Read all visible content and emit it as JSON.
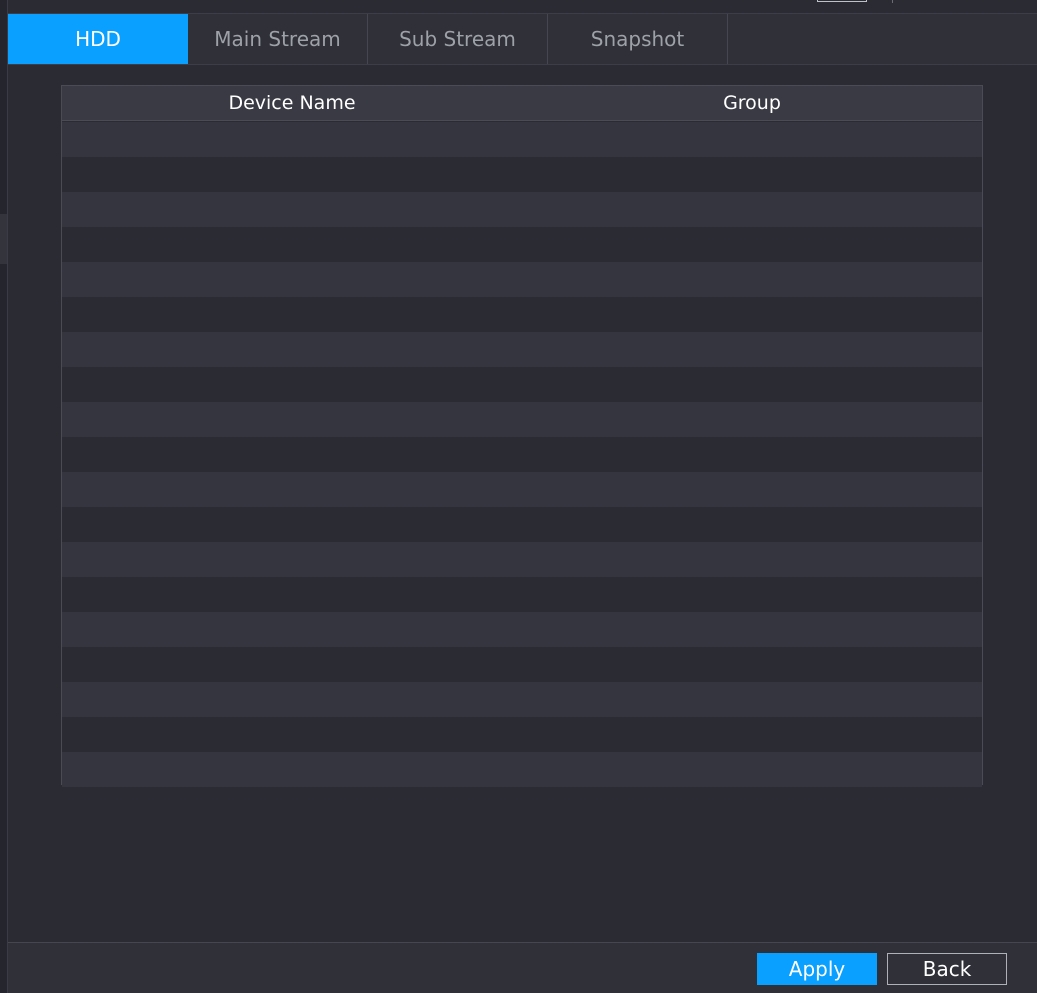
{
  "tabs": [
    {
      "label": "HDD",
      "active": true
    },
    {
      "label": "Main Stream",
      "active": false
    },
    {
      "label": "Sub Stream",
      "active": false
    },
    {
      "label": "Snapshot",
      "active": false
    }
  ],
  "table": {
    "columns": [
      "Device Name",
      "Group"
    ],
    "rows": []
  },
  "footer": {
    "apply_label": "Apply",
    "back_label": "Back"
  },
  "colors": {
    "accent": "#0aa0ff",
    "background": "#2a2b33",
    "header": "#393a43",
    "row_alt": "#34353e"
  }
}
